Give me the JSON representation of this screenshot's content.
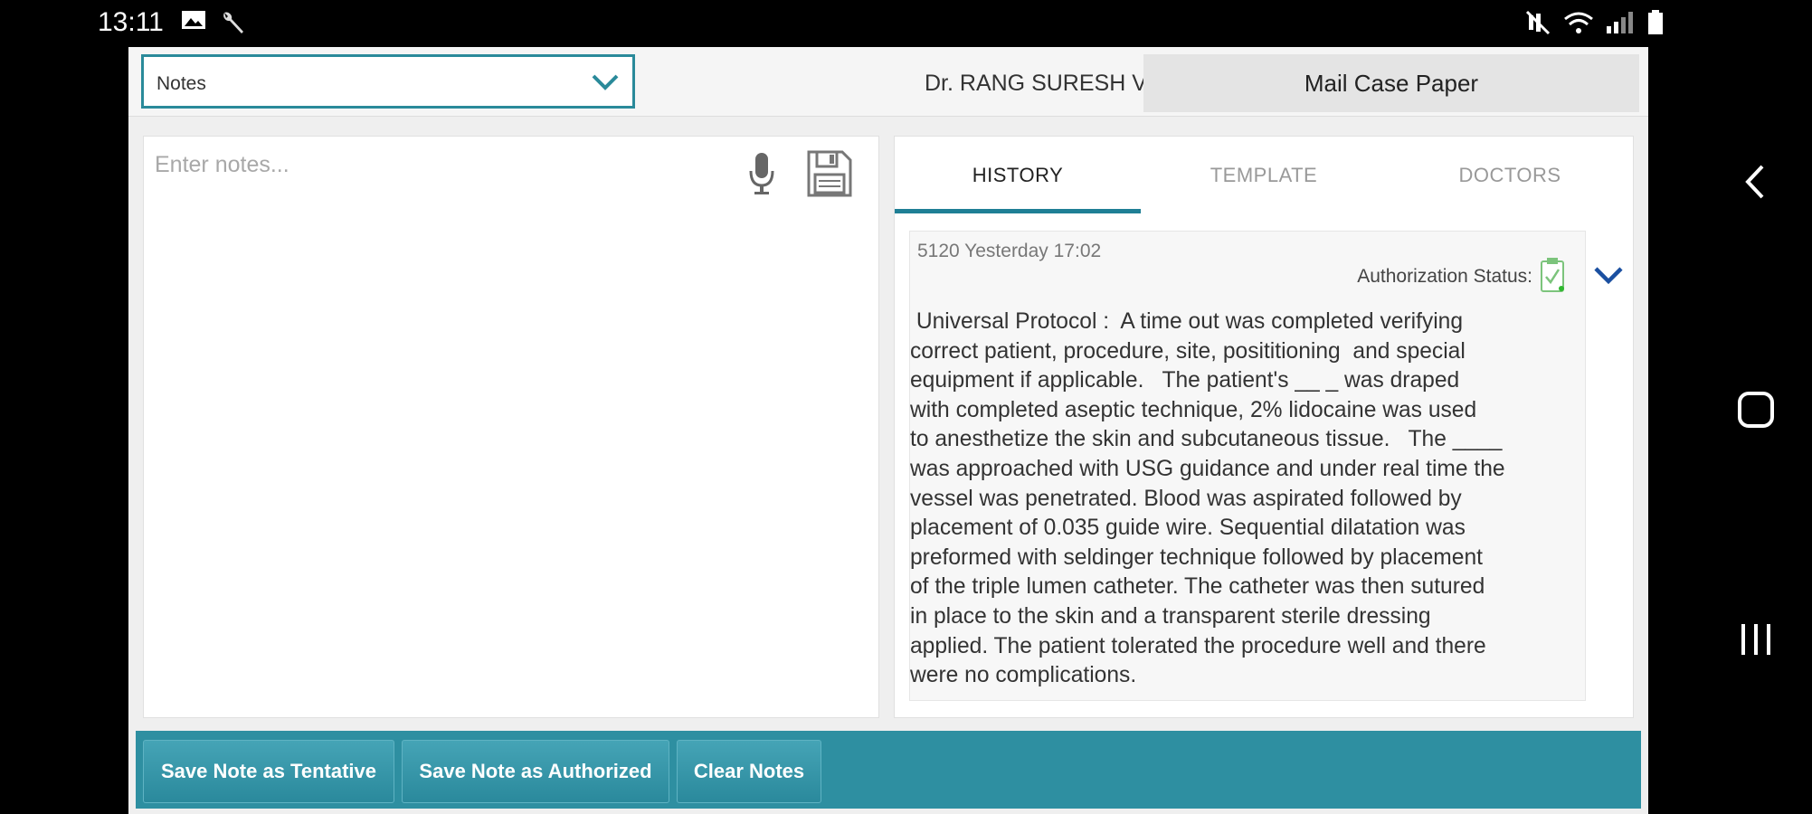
{
  "status_bar": {
    "time": "13:11",
    "left_icons": [
      "image-icon",
      "wrench-icon"
    ],
    "right_icons": [
      "mute-icon",
      "wifi-icon",
      "signal-icon",
      "battery-icon"
    ]
  },
  "header": {
    "dropdown_value": "Notes",
    "doctor_name": "Dr. RANG SURESH V",
    "mail_button": "Mail Case Paper"
  },
  "notes": {
    "placeholder": "Enter notes..."
  },
  "tabs": [
    {
      "label": "HISTORY",
      "active": true
    },
    {
      "label": "TEMPLATE",
      "active": false
    },
    {
      "label": "DOCTORS",
      "active": false
    }
  ],
  "history": {
    "meta": "5120 Yesterday 17:02",
    "auth_label": "Authorization Status:",
    "note": " Universal Protocol :  A time out was completed verifying\ncorrect patient, procedure, site, posititioning  and special\nequipment if applicable.   The patient's __ _ was draped\nwith completed aseptic technique, 2% lidocaine was used\nto anesthetize the skin and subcutaneous tissue.   The ____\nwas approached with USG guidance and under real time the\nvessel was penetrated. Blood was aspirated followed by\nplacement of 0.035 guide wire. Sequential dilatation was\npreformed with seldinger technique followed by placement\nof the triple lumen catheter. The catheter was then sutured\nin place to the skin and a transparent sterile dressing\napplied. The patient tolerated the procedure well and there\nwere no complications."
  },
  "actions": {
    "save_tentative": "Save Note as Tentative",
    "save_authorized": "Save Note as Authorized",
    "clear": "Clear Notes"
  },
  "colors": {
    "accent": "#2e8fa1",
    "tab_indicator": "#1f7f95",
    "chevron": "#1a4fa0"
  },
  "nav_icons": [
    "back-icon",
    "home-icon",
    "recents-icon"
  ]
}
